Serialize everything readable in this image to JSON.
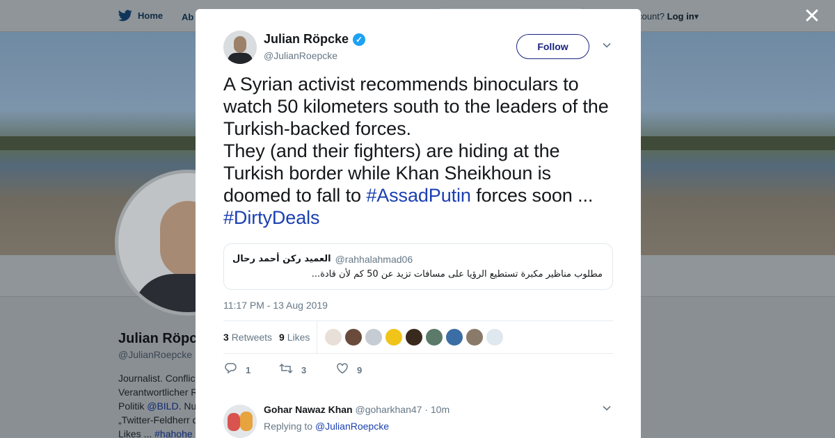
{
  "nav": {
    "home": "Home",
    "about": "Ab",
    "account_prefix": "count?",
    "login": "Log in"
  },
  "background_profile": {
    "name": "Julian Röpc",
    "handle": "@JulianRoepcke",
    "bio_lines": [
      "Journalist. Conflic",
      "Verantwortlicher R",
      "Politik ",
      "„Twitter-Feldherr d",
      "Likes ... "
    ],
    "bio_links": [
      "@BILD",
      "#hahohe"
    ],
    "bio_tail": ". Nu"
  },
  "tweet": {
    "author_name": "Julian Röpcke",
    "author_handle": "@JulianRoepcke",
    "follow_label": "Follow",
    "text_part1": "A Syrian activist recommends binoculars to watch 50 kilometers south to the leaders of the Turkish-backed forces.",
    "text_part2": "They (and their fighters) are hiding at the Turkish border while Khan Sheikhoun is doomed to fall to ",
    "hashtag1": "#AssadPutin",
    "text_part3": " forces soon ...",
    "hashtag2": "#DirtyDeals",
    "quote": {
      "name": "العميد ركن أحمد رحال",
      "handle": "@rahhalahmad06",
      "text": "مطلوب مناظير مكبرة تستطيع الرؤيا على مسافات تزيد عن 50 كم لأن قادة..."
    },
    "timestamp": "11:17 PM - 13 Aug 2019",
    "retweets_count": "3",
    "retweets_label": "Retweets",
    "likes_count": "9",
    "likes_label": "Likes",
    "liker_colors": [
      "#e8e0d8",
      "#6a4a3a",
      "#c5ccd3",
      "#f0c419",
      "#3a2a1e",
      "#5b7a6a",
      "#3b6ea5",
      "#8a7a6a",
      "#dfe7ef"
    ],
    "actions": {
      "replies": "1",
      "retweets": "3",
      "likes": "9"
    }
  },
  "reply": {
    "name": "Gohar Nawaz Khan",
    "handle": "@goharkhan47",
    "time": "· 10m",
    "replying_prefix": "Replying to ",
    "replying_to": "@JulianRoepcke"
  }
}
